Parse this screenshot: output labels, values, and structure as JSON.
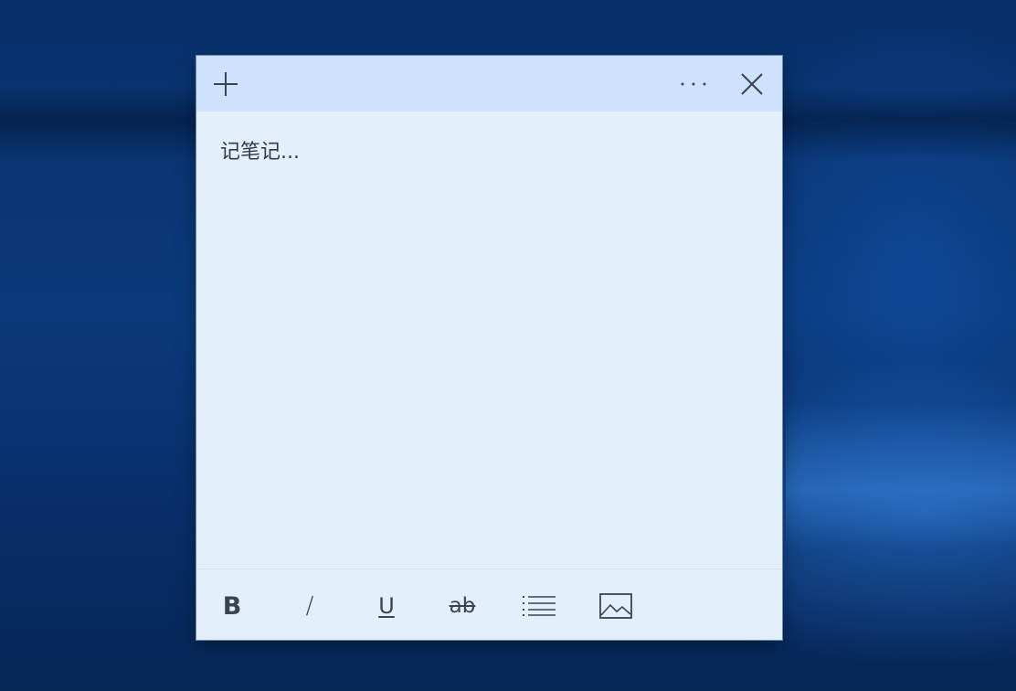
{
  "note": {
    "placeholder": "记笔记..."
  },
  "toolbar": {
    "bold_label": "B",
    "italic_label": "/",
    "underline_label": "U",
    "strike_label": "ab"
  },
  "icons": {
    "add": "plus-icon",
    "more": "more-horizontal-icon",
    "close": "close-icon",
    "list": "bullet-list-icon",
    "image": "image-icon"
  },
  "colors": {
    "note_background": "#e4effc",
    "header_background": "#cde3fb",
    "icon_color": "#3b4250",
    "desktop_background": "#0a3a7c"
  }
}
